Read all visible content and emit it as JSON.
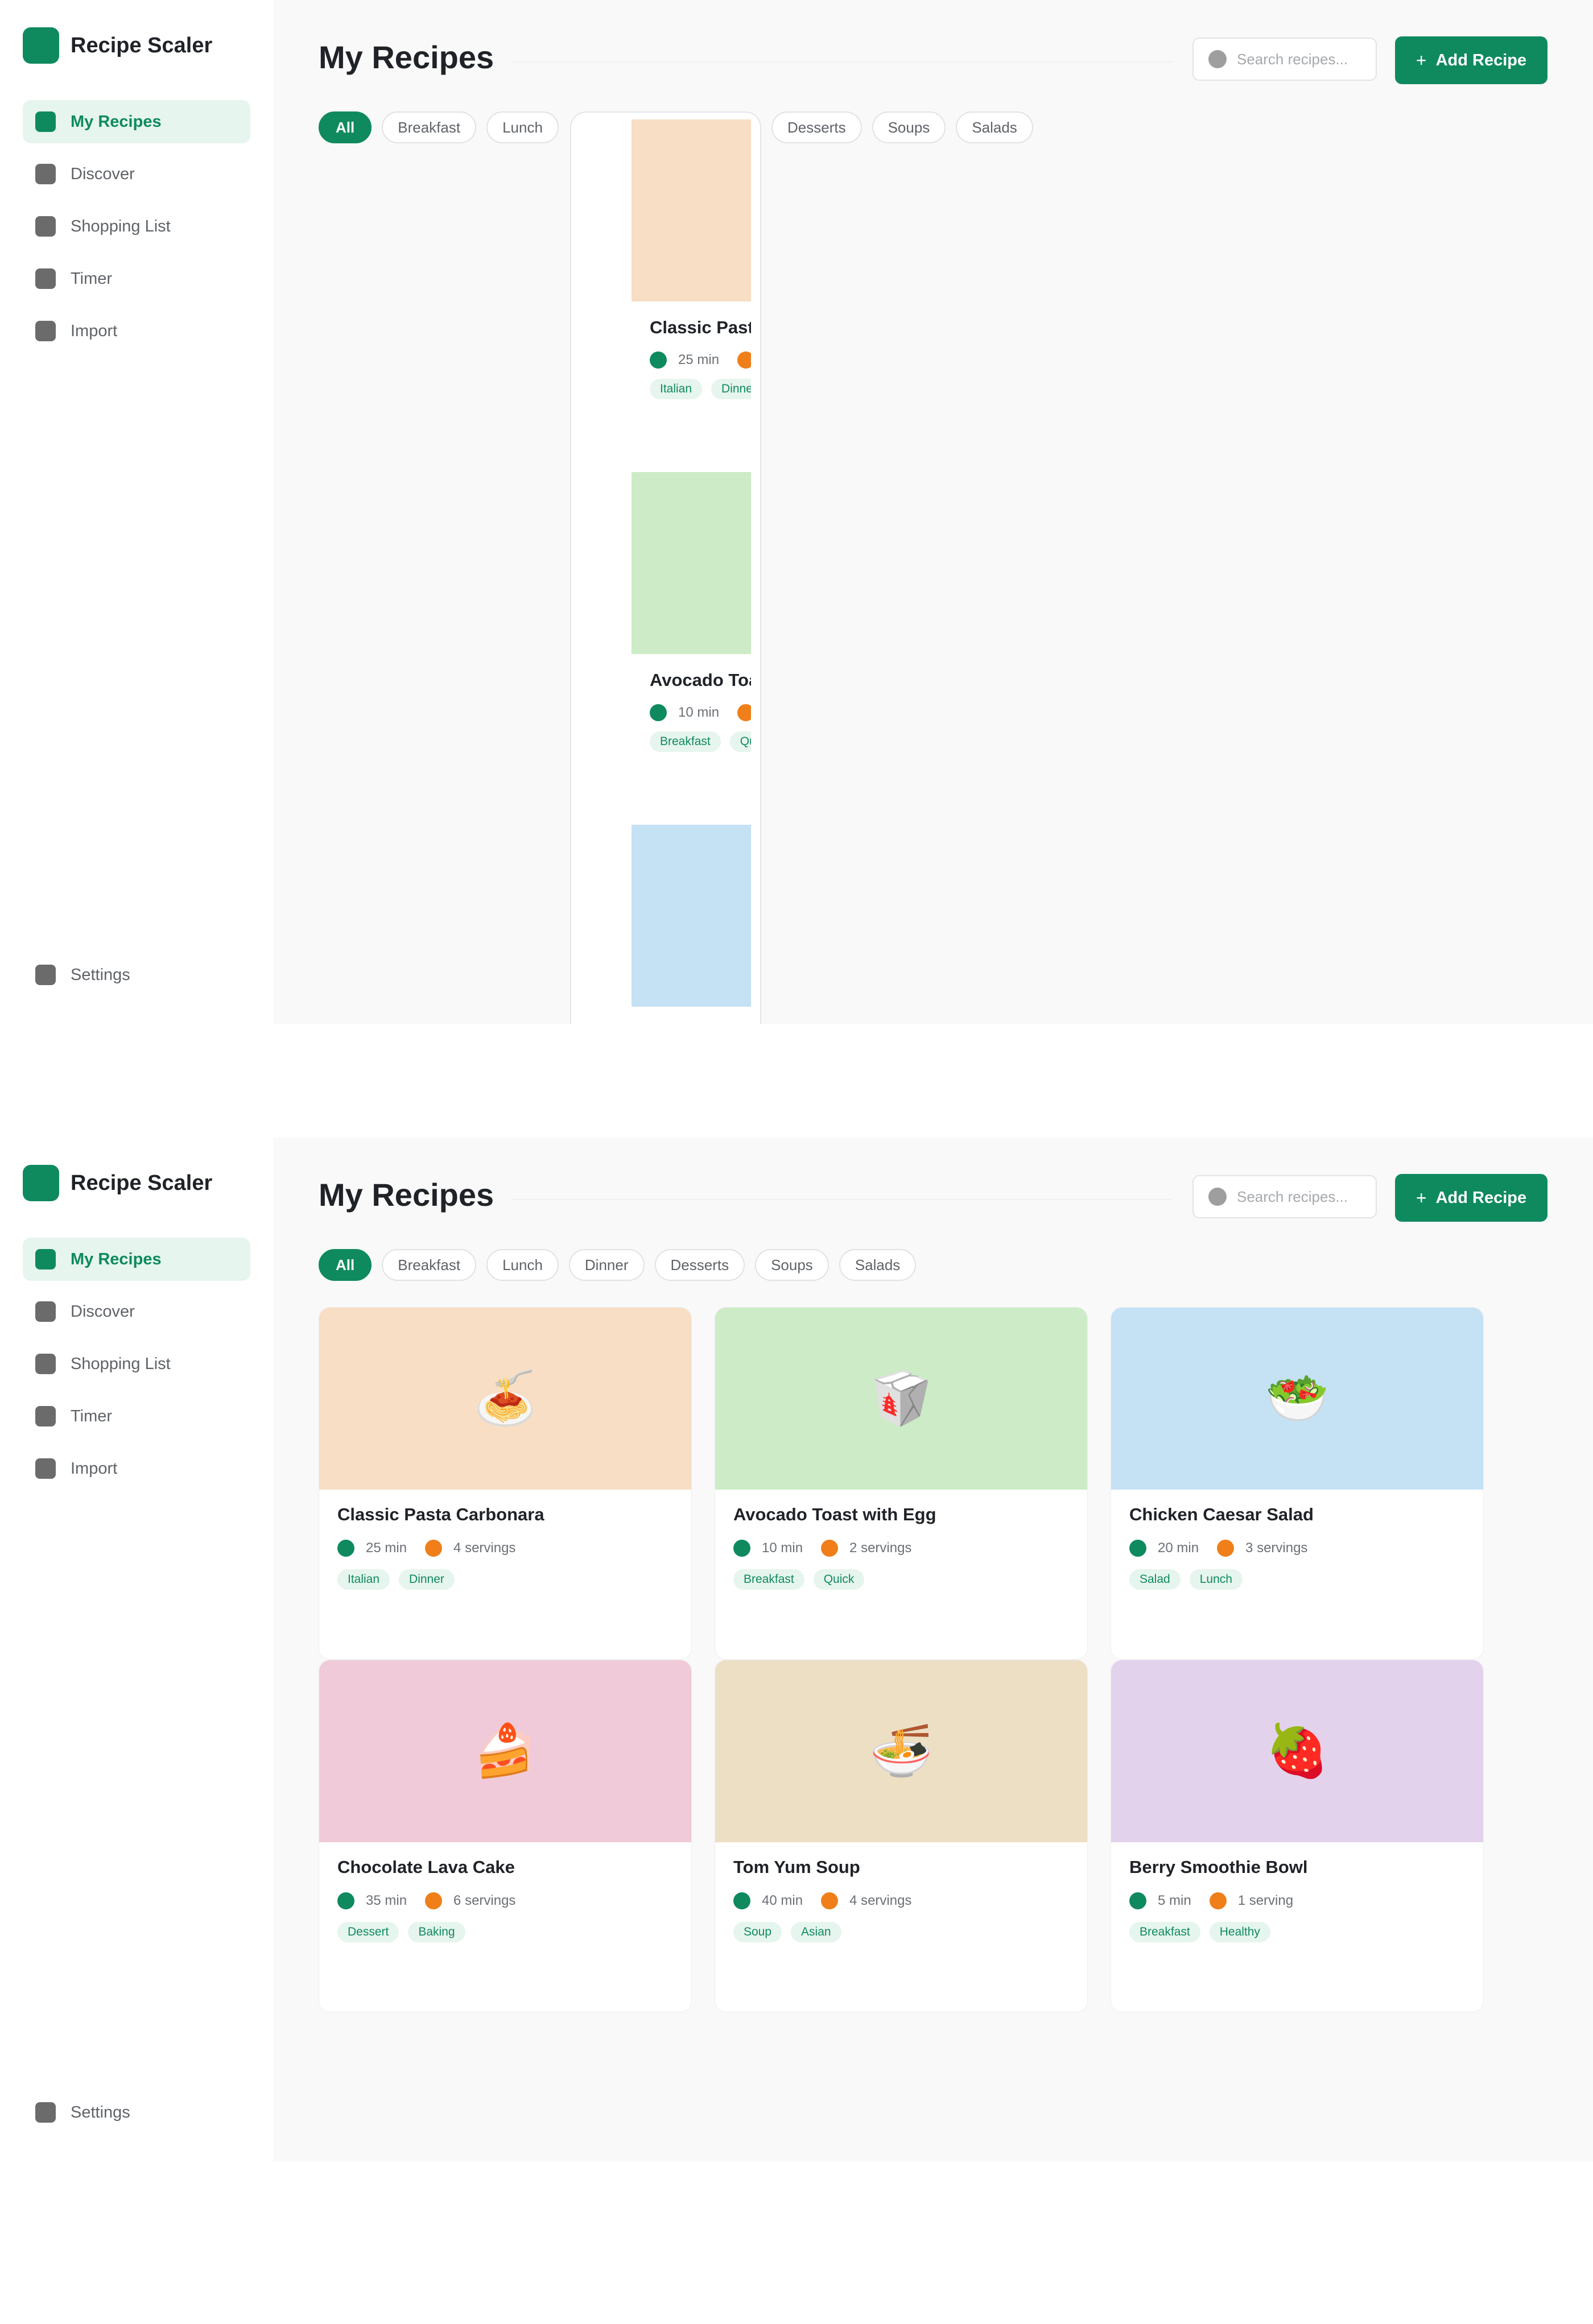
{
  "app": {
    "name": "Recipe Scaler"
  },
  "sidebar": {
    "items": [
      {
        "label": "My Recipes",
        "active": true
      },
      {
        "label": "Discover"
      },
      {
        "label": "Shopping List"
      },
      {
        "label": "Timer"
      },
      {
        "label": "Import"
      }
    ],
    "settings_label": "Settings"
  },
  "header": {
    "title": "My Recipes",
    "search_placeholder": "Search recipes...",
    "add_button_label": "Add Recipe",
    "add_button_icon": "+"
  },
  "filters": [
    "All",
    "Breakfast",
    "Lunch",
    "Dinner",
    "Desserts",
    "Soups",
    "Salads"
  ],
  "recipes": [
    {
      "title": "Classic Pasta Carbonara",
      "time": "25 min",
      "servings": "4 servings",
      "tags": [
        "Italian",
        "Dinner"
      ],
      "image_color": "#f7dec4",
      "icon": "🍝"
    },
    {
      "title": "Avocado Toast with Egg",
      "time": "10 min",
      "servings": "2 servings",
      "tags": [
        "Breakfast",
        "Quick"
      ],
      "image_color": "#ccebc6",
      "icon": "🥡"
    },
    {
      "title": "Chicken Caesar Salad",
      "time": "20 min",
      "servings": "3 servings",
      "tags": [
        "Salad",
        "Lunch"
      ],
      "image_color": "#c5e1f4",
      "icon": "🥗"
    },
    {
      "title": "Chocolate Lava Cake",
      "time": "35 min",
      "servings": "6 servings",
      "tags": [
        "Dessert",
        "Baking"
      ],
      "image_color": "#f0cad9",
      "icon": "🍰"
    },
    {
      "title": "Tom Yum Soup",
      "time": "40 min",
      "servings": "4 servings",
      "tags": [
        "Soup",
        "Asian"
      ],
      "image_color": "#eddfc4",
      "icon": "🍜"
    },
    {
      "title": "Berry Smoothie Bowl",
      "time": "5 min",
      "servings": "1 serving",
      "tags": [
        "Breakfast",
        "Healthy"
      ],
      "image_color": "#e3d2ec",
      "icon": "🍓"
    }
  ],
  "colors": {
    "accent": "#0f8a5f",
    "time_dot": "#0f8a5f",
    "servings_dot": "#f07f1a"
  }
}
